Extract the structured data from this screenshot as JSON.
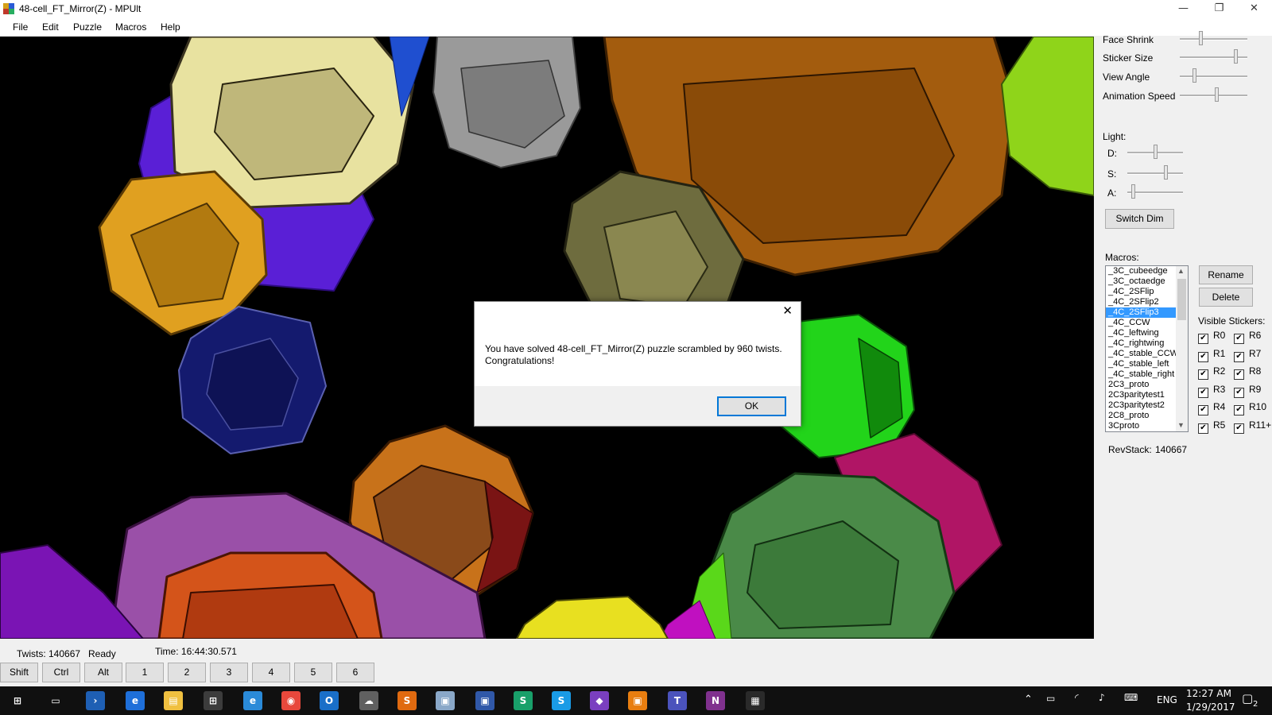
{
  "window": {
    "title": "48-cell_FT_Mirror(Z) - MPUlt",
    "minimize_glyph": "—",
    "maximize_glyph": "❐",
    "close_glyph": "✕"
  },
  "menu": [
    "File",
    "Edit",
    "Puzzle",
    "Macros",
    "Help"
  ],
  "panel": {
    "sliders": [
      {
        "label": "Face Shrink",
        "value": 0.3
      },
      {
        "label": "Sticker Size",
        "value": 0.85
      },
      {
        "label": "View Angle",
        "value": 0.2
      },
      {
        "label": "Animation Speed",
        "value": 0.55
      }
    ],
    "light": {
      "title": "Light:",
      "d_label": "D:",
      "d_value": 0.5,
      "s_label": "S:",
      "s_value": 0.7,
      "a_label": "A:",
      "a_value": 0.08
    },
    "switch_dim": "Switch Dim",
    "macros_label": "Macros:",
    "macros": [
      "_3C_cubeedge",
      "_3C_octaedge",
      "_4C_2SFlip",
      "_4C_2SFlip2",
      "_4C_2SFlip3",
      "_4C_CCW",
      "_4C_leftwing",
      "_4C_rightwing",
      "_4C_stable_CCW",
      "_4C_stable_left",
      "_4C_stable_right",
      "2C3_proto",
      "2C3paritytest1",
      "2C3paritytest2",
      "2C8_proto",
      "3Cproto"
    ],
    "selected_macro": "_4C_2SFlip3",
    "rename": "Rename",
    "delete": "Delete",
    "visible_stickers_label": "Visible Stickers:",
    "stickers_left": [
      "R0",
      "R1",
      "R2",
      "R3",
      "R4",
      "R5"
    ],
    "stickers_right": [
      "R6",
      "R7",
      "R8",
      "R9",
      "R10",
      "R11+"
    ],
    "check_glyph": "✔",
    "revstack_label": "RevStack:",
    "revstack_value": "140667"
  },
  "status": {
    "twists": "Twists: 140667",
    "state": "Ready",
    "time": "Time: 16:44:30.571",
    "keys": [
      "Shift",
      "Ctrl",
      "Alt",
      "1",
      "2",
      "3",
      "4",
      "5",
      "6"
    ]
  },
  "dialog": {
    "line1": "You have solved 48-cell_FT_Mirror(Z) puzzle scrambled by 960 twists.",
    "line2": "Congratulations!",
    "ok": "OK",
    "close_glyph": "✕"
  },
  "taskbar": {
    "apps": [
      "windows-start-icon",
      "task-view-icon",
      "powershell-icon",
      "edge-icon",
      "file-explorer-icon",
      "store-icon",
      "ie-icon",
      "chrome-icon",
      "outlook-icon",
      "cloud-icon",
      "sublime-icon",
      "photos-icon",
      "remote-desktop-icon",
      "sway-icon",
      "skype-icon",
      "visual-studio-icon",
      "office-icon",
      "teams-icon",
      "onenote-icon",
      "mpult-icon"
    ],
    "language": "ENG",
    "time": "12:27 AM",
    "date": "1/29/2017",
    "notification_count": "2"
  },
  "colors": {
    "viewport_bg": "#000000",
    "selection": "#3399ff",
    "dialog_button_border": "#0078d7"
  }
}
